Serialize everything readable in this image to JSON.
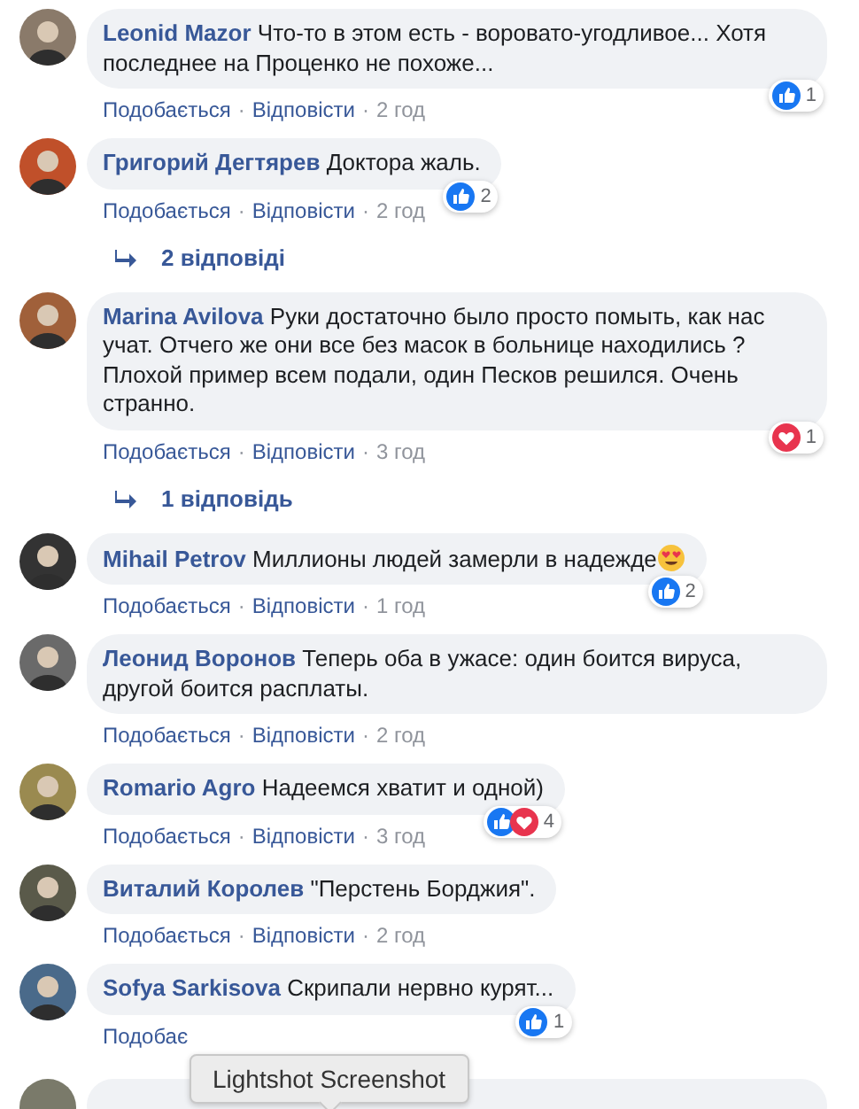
{
  "comments": [
    {
      "author": "Leonid Mazor",
      "text": "Что-то в этом есть - воровато-угодливое... Хотя последнее на Проценко не похоже...",
      "reactions": {
        "like": true,
        "love": false,
        "count": "1"
      },
      "actions": {
        "like": "Подобається",
        "sep1": "·",
        "reply": "Відповісти",
        "sep2": "·",
        "time": "2 год"
      }
    },
    {
      "author": "Григорий Дегтярев",
      "text": "Доктора жаль.",
      "reactions": {
        "like": true,
        "love": false,
        "count": "2"
      },
      "actions": {
        "like": "Подобається",
        "sep1": "·",
        "reply": "Відповісти",
        "sep2": "·",
        "time": "2 год"
      },
      "replies_link": "2 відповіді"
    },
    {
      "author": "Marina Avilova",
      "text": "Руки достаточно было просто помыть, как нас учат. Отчего же они все без масок в больнице находились ? Плохой пример всем подали, один Песков решился. Очень странно.",
      "reactions": {
        "like": false,
        "love": true,
        "count": "1"
      },
      "actions": {
        "like": "Подобається",
        "sep1": "·",
        "reply": "Відповісти",
        "sep2": "·",
        "time": "3 год"
      },
      "replies_link": "1 відповідь"
    },
    {
      "author": "Mihail Petrov",
      "text": "Миллионы людей замерли в надежде",
      "heart_eyes_emoji": true,
      "reactions": {
        "like": true,
        "love": false,
        "count": "2"
      },
      "actions": {
        "like": "Подобається",
        "sep1": "·",
        "reply": "Відповісти",
        "sep2": "·",
        "time": "1 год"
      }
    },
    {
      "author": "Леонид Воронов",
      "text": "Теперь оба в ужасе: один боится вируса, другой боится расплаты.",
      "actions": {
        "like": "Подобається",
        "sep1": "·",
        "reply": "Відповісти",
        "sep2": "·",
        "time": "2 год"
      }
    },
    {
      "author": "Romario Agro",
      "text": "Надеемся хватит и одной)",
      "reactions": {
        "like": true,
        "love": true,
        "count": "4"
      },
      "actions": {
        "like": "Подобається",
        "sep1": "·",
        "reply": "Відповісти",
        "sep2": "·",
        "time": "3 год"
      }
    },
    {
      "author": "Виталий Королев",
      "text": "\"Перстень Борджия\".",
      "actions": {
        "like": "Подобається",
        "sep1": "·",
        "reply": "Відповісти",
        "sep2": "·",
        "time": "2 год"
      }
    },
    {
      "author": "Sofya Sarkisova",
      "text": "Скрипали нервно курят...",
      "reactions": {
        "like": true,
        "love": false,
        "count": "1"
      },
      "actions": {
        "like": "Подобає"
      }
    }
  ],
  "tooltip": {
    "text": "Lightshot Screenshot"
  }
}
